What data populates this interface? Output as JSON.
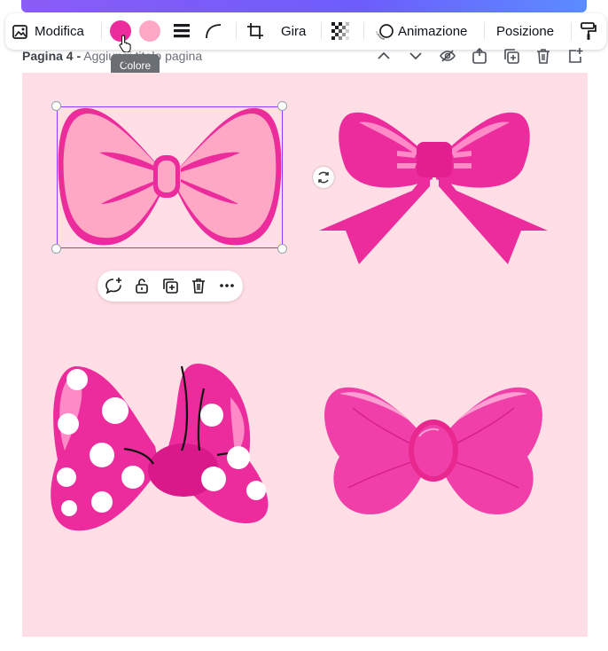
{
  "toolbar": {
    "edit_label": "Modifica",
    "flip_label": "Gira",
    "animation_label": "Animazione",
    "position_label": "Posizione"
  },
  "colors": {
    "primary_swatch": "#ec2b9c",
    "secondary_swatch": "#ffa8c5",
    "canvas_bg": "#ffdfe5",
    "selection": "#8b3dff"
  },
  "tooltip": {
    "label": "Colore"
  },
  "page": {
    "label": "Pagina 4 -",
    "title_placeholder": "Aggiungi titolo pagina"
  },
  "icons": [
    "image-edit-icon",
    "line-weight-icon",
    "corner-radius-icon",
    "crop-icon",
    "transparency-icon",
    "animation-icon",
    "paint-roller-icon",
    "chevron-up-icon",
    "chevron-down-icon",
    "eye-off-icon",
    "lock-page-icon",
    "duplicate-page-icon",
    "trash-icon",
    "add-page-icon",
    "comment-icon",
    "lock-icon",
    "duplicate-icon",
    "more-icon",
    "rotate-icon"
  ]
}
